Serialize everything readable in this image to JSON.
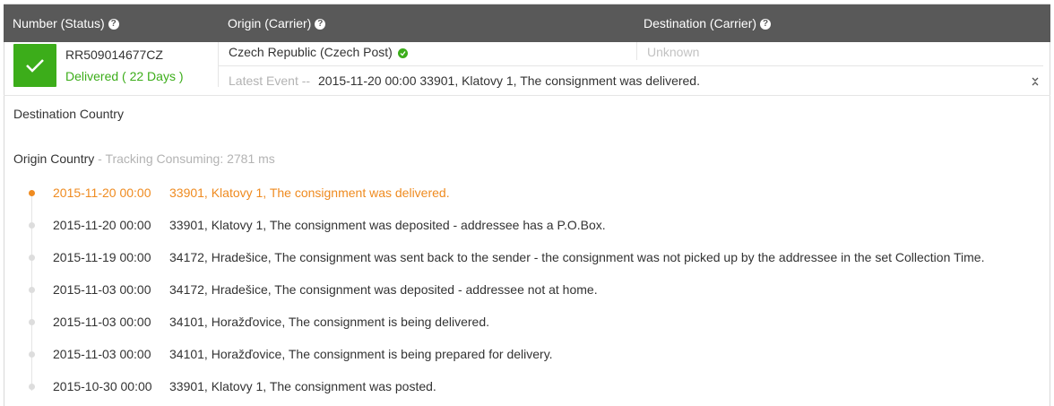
{
  "header": {
    "number_status": "Number (Status)",
    "origin_carrier": "Origin (Carrier)",
    "destination_carrier": "Destination (Carrier)",
    "help_icon": "question-circle-icon"
  },
  "shipment": {
    "tracking_number": "RR509014677CZ",
    "status": "Delivered ( 22 Days )",
    "status_color": "#3cad1a",
    "origin": "Czech Republic (Czech Post)",
    "destination": "Unknown",
    "latest_event_label": "Latest Event --",
    "latest_event": "2015-11-20 00:00 33901, Klatovy 1, The consignment was delivered."
  },
  "details": {
    "destination_country": "Destination Country",
    "origin_country": "Origin Country",
    "tracking_consuming": " - Tracking Consuming: 2781 ms"
  },
  "events": [
    {
      "date": "2015-11-20 00:00",
      "desc": "33901, Klatovy 1, The consignment was delivered."
    },
    {
      "date": "2015-11-20 00:00",
      "desc": "33901, Klatovy 1, The consignment was deposited - addressee has a P.O.Box."
    },
    {
      "date": "2015-11-19 00:00",
      "desc": "34172, Hradešice, The consignment was sent back to the sender - the consignment was not picked up by the addressee in the set Collection Time."
    },
    {
      "date": "2015-11-03 00:00",
      "desc": "34172, Hradešice, The consignment was deposited - addressee not at home."
    },
    {
      "date": "2015-11-03 00:00",
      "desc": "34101, Horažďovice, The consignment is being delivered."
    },
    {
      "date": "2015-11-03 00:00",
      "desc": "34101, Horažďovice, The consignment is being prepared for delivery."
    },
    {
      "date": "2015-10-30 00:00",
      "desc": "33901, Klatovy 1, The consignment was posted."
    }
  ],
  "colors": {
    "header_bg": "#595959",
    "delivered_green": "#3cad1a",
    "latest_event_orange": "#ef8b20"
  }
}
